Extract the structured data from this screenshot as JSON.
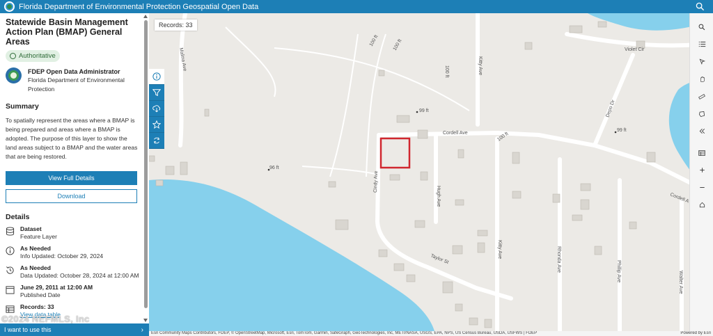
{
  "header": {
    "title": "Florida Department of Environmental Protection Geospatial Open Data"
  },
  "panel": {
    "layer_title": "Statewide Basin Management Action Plan (BMAP) General Areas",
    "badge": "Authoritative",
    "owner_name": "FDEP Open Data Administrator",
    "owner_org": "Florida Department of Environmental Protection",
    "summary_heading": "Summary",
    "summary_text": "To spatially represent the areas where a BMAP is being prepared and areas where a BMAP is adopted. The purpose of this layer to show the land areas subject to a BMAP and the water areas that are being restored.",
    "view_details_label": "View Full Details",
    "download_label": "Download",
    "details_heading": "Details",
    "details": [
      {
        "icon": "dataset-icon",
        "title": "Dataset",
        "value": "Feature Layer"
      },
      {
        "icon": "info-icon",
        "title": "As Needed",
        "value": "Info Updated: October 29, 2024"
      },
      {
        "icon": "history-icon",
        "title": "As Needed",
        "value": "Data Updated: October 28, 2024 at 12:00 AM"
      },
      {
        "icon": "calendar-icon",
        "title": "June 29, 2011 at 12:00 AM",
        "value": "Published Date"
      },
      {
        "icon": "table-icon",
        "title": "Records: 33",
        "link": "View data table"
      }
    ],
    "footer_label": "I want to use this",
    "watermark": "©2024 NEFMLS, Inc"
  },
  "map": {
    "records_label": "Records: 33",
    "roads": {
      "violet_cir": "Violet Cir",
      "cordell_ave": "Cordell Ave",
      "cordell_ave_2": "Cordell A",
      "cindy_ave": "Cindy Ave",
      "hugh_ave": "Hugh Ave",
      "kitty_ave": "Kitty Ave",
      "kitty_ave_2": "Kitty Ave",
      "taylor_st": "Taylor St",
      "rhonda_ave": "Rhonda Ave",
      "phillip_ave": "Phillip Ave",
      "walter_ave": "Walter Ave",
      "depo_dr": "Depo Dr",
      "malina_ave": "Malina Ave",
      "ft100_a": "100 ft",
      "ft100_b": "100 ft",
      "ft100_c": "100 ft",
      "ft100_d": "100 ft"
    },
    "elevations": {
      "e99a": "99 ft",
      "e99b": "99 ft",
      "e96": "96 ft"
    },
    "attribution": "Esri Community Maps Contributors, FDEP, © OpenStreetMap, Microsoft, Esri, TomTom, Garmin, SafeGraph, GeoTechnologies, Inc, METI/NASA, USGS, EPA, NPS, US Census Bureau, USDA, USFWS | FDEP",
    "powered_by": "Powered by Esri"
  },
  "colors": {
    "brand": "#1d7fb6",
    "water": "#86d0ec",
    "land": "#eceae6",
    "highlight": "#d0262e"
  }
}
